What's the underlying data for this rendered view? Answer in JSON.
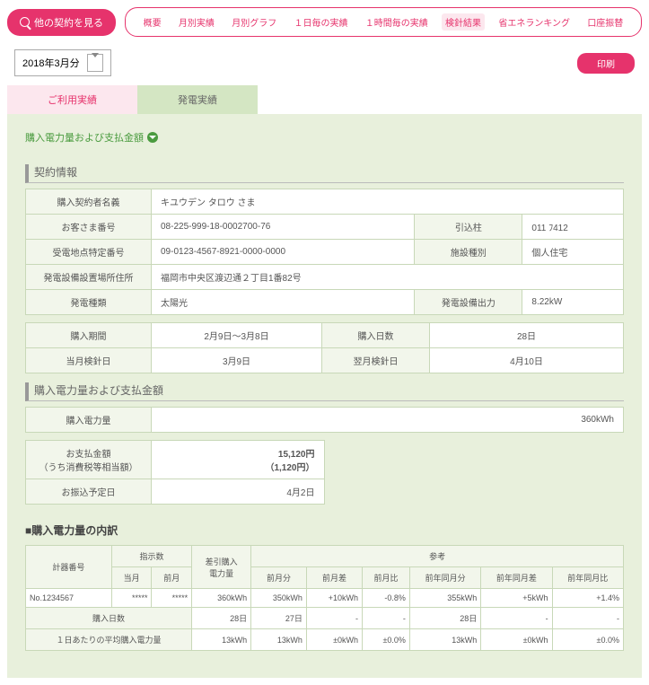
{
  "top": {
    "contract_btn": "他の契約を見る",
    "nav": [
      "概要",
      "月別実績",
      "月別グラフ",
      "１日毎の実績",
      "１時間毎の実績",
      "検針結果",
      "省エネランキング",
      "口座振替"
    ]
  },
  "filter": {
    "month": "2018年3月分",
    "print": "印刷"
  },
  "tabs": {
    "usage": "ご利用実績",
    "generation": "発電実績"
  },
  "link_title": "購入電力量および支払金額",
  "section1_title": "契約情報",
  "contract": {
    "name_label": "購入契約者名義",
    "name_value": "キユウデン  タロウ  さま",
    "cust_label": "お客さま番号",
    "cust_value": "08-225-999-18-0002700-76",
    "pole_label": "引込柱",
    "pole_value": "011 ﾌ412",
    "point_label": "受電地点特定番号",
    "point_value": "09-0123-4567-8921-0000-0000",
    "factype_label": "施設種別",
    "factype_value": "個人住宅",
    "addr_label": "発電設備設置場所住所",
    "addr_value": "福岡市中央区渡辺通２丁目1番82号",
    "gentype_label": "発電種類",
    "gentype_value": "太陽光",
    "output_label": "発電設備出力",
    "output_value": "8.22kW",
    "period_label": "購入期間",
    "period_value": "2月9日～3月8日",
    "days_label": "購入日数",
    "days_value": "28日",
    "read_label": "当月検針日",
    "read_value": "3月9日",
    "next_label": "翌月検針日",
    "next_value": "4月10日"
  },
  "section2_title": "購入電力量および支払金額",
  "purchase": {
    "amount_label": "購入電力量",
    "amount_value": "360kWh",
    "pay_label1": "お支払金額",
    "pay_label2": "（うち消費税等相当額）",
    "pay_value1": "15,120円",
    "pay_value2": "（1,120円）",
    "transfer_label": "お振込予定日",
    "transfer_value": "4月2日"
  },
  "breakdown": {
    "title": "■購入電力量の内訳",
    "h_meter": "計器番号",
    "h_reading": "指示数",
    "h_diff": "差引購入\n電力量",
    "h_ref": "参考",
    "h_cur": "当月",
    "h_prev": "前月",
    "h_prevm": "前月分",
    "h_prevdiff": "前月差",
    "h_prevratio": "前月比",
    "h_lastyear": "前年同月分",
    "h_lastyeardiff": "前年同月差",
    "h_lastyearratio": "前年同月比",
    "meter_no": "No.1234567",
    "cur_v": "*****",
    "prev_v": "*****",
    "diff_v": "360kWh",
    "prevm_v": "350kWh",
    "prevdiff_v": "+10kWh",
    "prevratio_v": "-0.8%",
    "lastyear_v": "355kWh",
    "lastyeardiff_v": "+5kWh",
    "lastyearratio_v": "+1.4%",
    "days_label": "購入日数",
    "days_cur": "28日",
    "days_prev": "27日",
    "days_ly": "28日",
    "avg_label": "１日あたりの平均購入電力量",
    "avg_cur": "13kWh",
    "avg_prev": "13kWh",
    "avg_diff": "±0kWh",
    "avg_ratio": "±0.0%",
    "avg_ly": "13kWh",
    "avg_lydiff": "±0kWh",
    "avg_lyratio": "±0.0%",
    "dash": "-"
  }
}
